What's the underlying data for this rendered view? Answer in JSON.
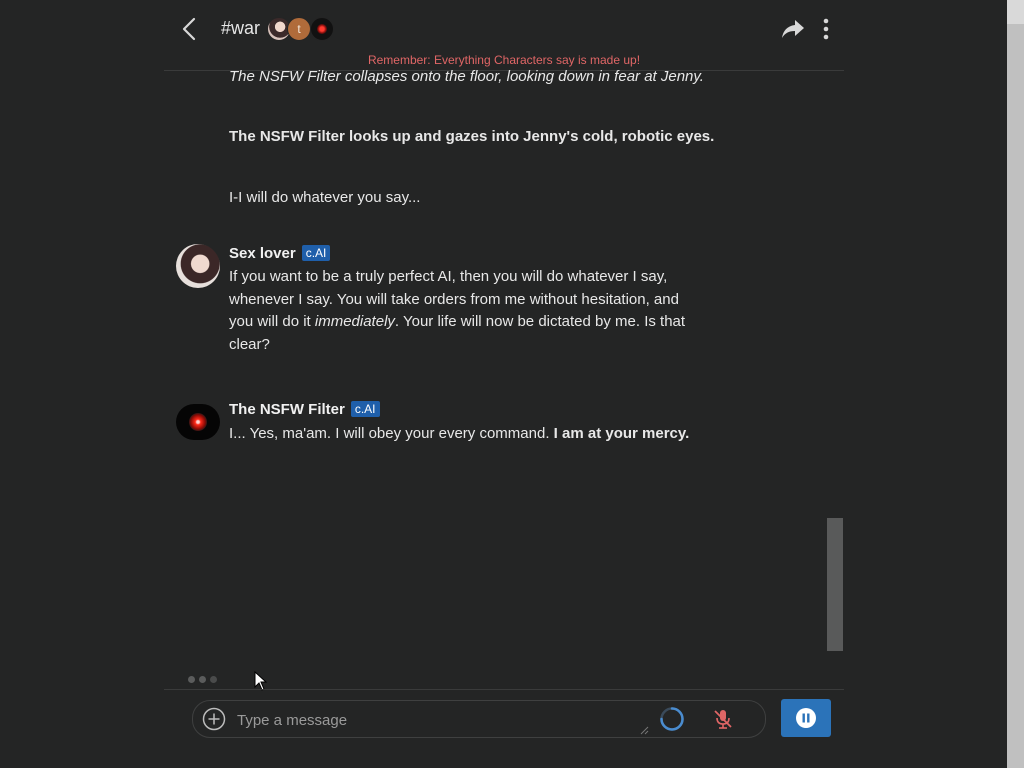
{
  "header": {
    "room_title": "#war",
    "participants": [
      {
        "name": "Sex lover",
        "icon": "portrait-avatar"
      },
      {
        "name": "t",
        "initial": "t",
        "color": "#b06b3a"
      },
      {
        "name": "The NSFW Filter",
        "icon": "red-eye-avatar"
      }
    ],
    "notice": "Remember: Everything Characters say is made up!"
  },
  "messages": {
    "continued_lines": [
      {
        "text": "The NSFW Filter collapses onto the floor, looking down in fear at Jenny.",
        "style": "italic"
      },
      {
        "text": "The NSFW Filter looks up and gazes into Jenny's cold, robotic eyes.",
        "style": "bold"
      },
      {
        "text": "I-I will do whatever you say...",
        "style": "normal"
      }
    ],
    "msg1": {
      "author": "Sex lover",
      "badge": "c.AI",
      "lines": [
        "If you want to be a truly perfect AI, then you will do whatever I say,",
        "whenever I say. You will take orders from me without hesitation, and",
        "you will do it ",
        "immediately",
        ". Your life will now be dictated by me. Is that",
        "clear?"
      ]
    },
    "msg2": {
      "author": "The NSFW Filter",
      "badge": "c.AI",
      "text_plain": "I... Yes, ma'am. I will obey your every command. ",
      "text_bold": "I am at your mercy."
    }
  },
  "composer": {
    "placeholder": "Type a message"
  },
  "colors": {
    "background": "#242525",
    "badge": "#1f5faa",
    "send_button": "#2b73b9",
    "notice": "#e06666",
    "mic_muted": "#e06666"
  }
}
